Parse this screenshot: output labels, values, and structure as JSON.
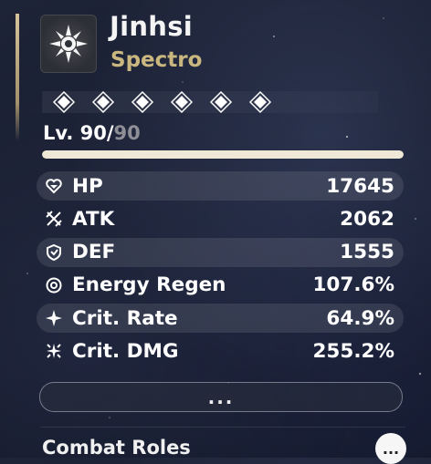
{
  "character": {
    "name": "Jinhsi",
    "element": "Spectro",
    "icon": "spectro-element-icon"
  },
  "resonance_chain": {
    "nodes": 6,
    "icon": "diamond-node-icon"
  },
  "level": {
    "current": "Lv. 90/",
    "max": "90",
    "progress": 1.0
  },
  "stats": [
    {
      "label": "HP",
      "value": "17645",
      "icon": "hp-heart-icon"
    },
    {
      "label": "ATK",
      "value": "2062",
      "icon": "atk-swords-icon"
    },
    {
      "label": "DEF",
      "value": "1555",
      "icon": "def-shield-icon"
    },
    {
      "label": "Energy Regen",
      "value": "107.6%",
      "icon": "energy-regen-icon"
    },
    {
      "label": "Crit. Rate",
      "value": "64.9%",
      "icon": "crit-rate-icon"
    },
    {
      "label": "Crit. DMG",
      "value": "255.2%",
      "icon": "crit-dmg-icon"
    }
  ],
  "more_button": {
    "label": "...",
    "icon": "more-dots-icon"
  },
  "section": {
    "title": "Combat Roles",
    "info_label": "...",
    "info_icon": "info-dots-icon"
  },
  "colors": {
    "accent": "#cab780",
    "bar_fill": "#efe8d6"
  }
}
